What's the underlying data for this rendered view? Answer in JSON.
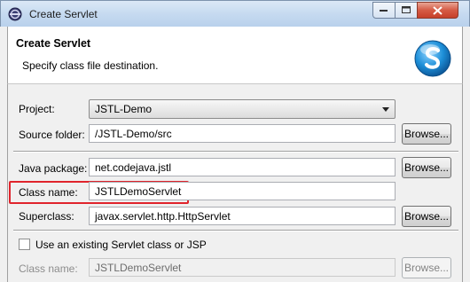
{
  "window": {
    "title": "Create Servlet"
  },
  "header": {
    "title": "Create Servlet",
    "subtitle": "Specify class file destination."
  },
  "form": {
    "project_label": "Project:",
    "project_value": "JSTL-Demo",
    "source_folder_label": "Source folder:",
    "source_folder_value": "/JSTL-Demo/src",
    "java_package_label": "Java package:",
    "java_package_value": "net.codejava.jstl",
    "class_name_label": "Class name:",
    "class_name_value": "JSTLDemoServlet",
    "superclass_label": "Superclass:",
    "superclass_value": "javax.servlet.http.HttpServlet",
    "browse_label": "Browse...",
    "existing_checkbox_label": "Use an existing Servlet class or JSP",
    "existing_checked": false,
    "existing_class_name_label": "Class name:",
    "existing_class_name_value": "JSTLDemoServlet"
  },
  "colors": {
    "highlight": "#e0242c",
    "logo": "#1d8fd8"
  }
}
